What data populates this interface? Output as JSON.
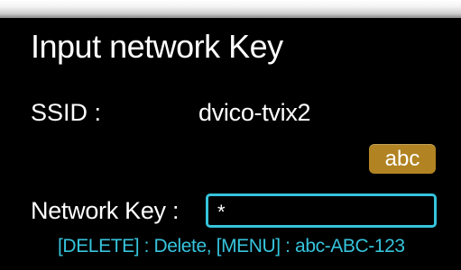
{
  "dialog": {
    "title": "Input network Key",
    "ssid": {
      "label": "SSID :",
      "value": "dvico-tvix2"
    },
    "input_mode_button": "abc",
    "network_key": {
      "label": "Network Key :",
      "value": "*"
    },
    "hint": "[DELETE] : Delete, [MENU] : abc-ABC-123"
  },
  "colors": {
    "background": "#000000",
    "text": "#ffffff",
    "accent_cyan": "#36c4dc",
    "button_gold": "#b18322"
  }
}
